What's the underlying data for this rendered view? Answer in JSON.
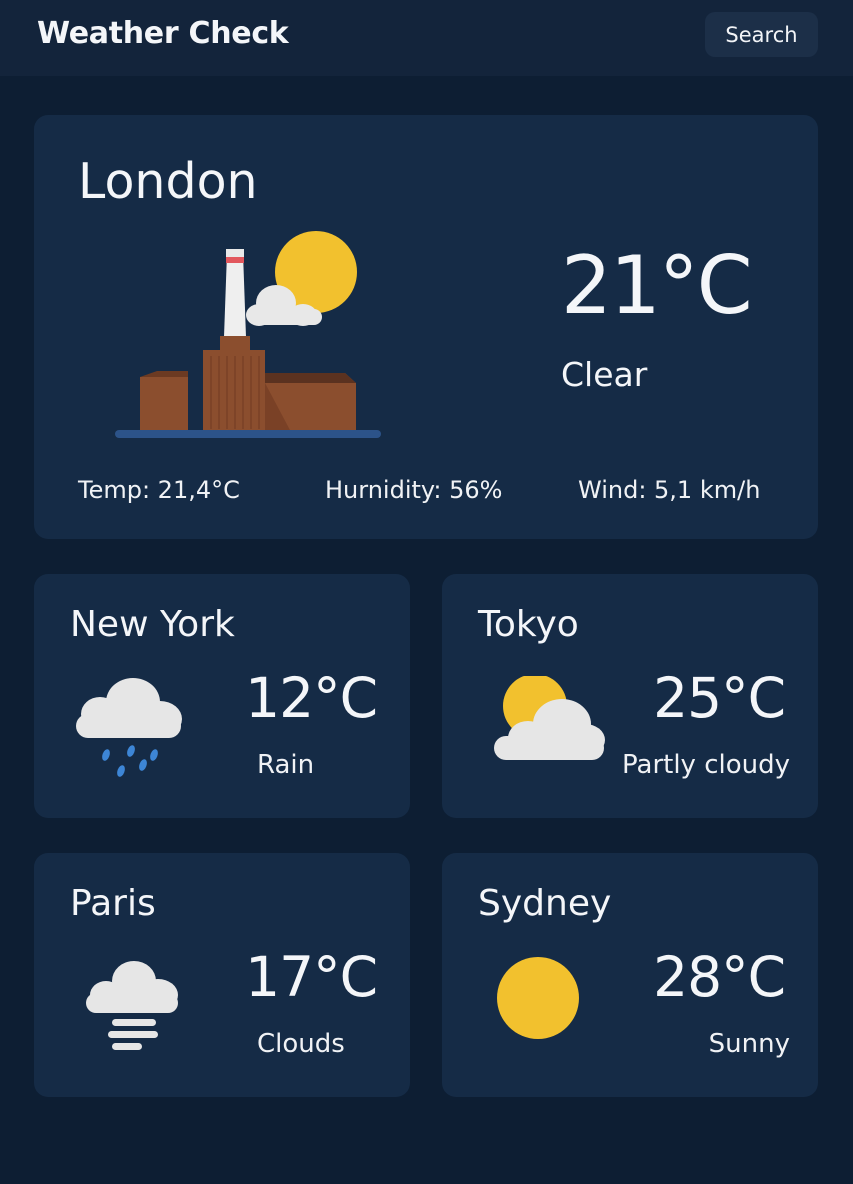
{
  "app": {
    "title": "Weather Check",
    "search_label": "Search"
  },
  "colors": {
    "background": "#0d1e33",
    "topbar": "#13243b",
    "card": "#152b46",
    "sun": "#f2c12e",
    "cloud": "#e6e6e6",
    "rain": "#3d86d6",
    "building": "#8b4e2e"
  },
  "featured": {
    "city": "London",
    "temperature": "21°C",
    "condition": "Clear",
    "icon": "london-power-station-sun-icon",
    "stats": {
      "temp": "Temp: 21,4°C",
      "humidity": "Hurnidity: 56%",
      "wind": "Wind: 5,1 km/h"
    }
  },
  "cities": [
    {
      "name": "New York",
      "temperature": "12°C",
      "condition": "Rain",
      "icon": "rain-cloud-icon"
    },
    {
      "name": "Tokyo",
      "temperature": "25°C",
      "condition": "Partly cloudy",
      "icon": "partly-cloudy-icon"
    },
    {
      "name": "Paris",
      "temperature": "17°C",
      "condition": "Clouds",
      "icon": "cloud-fog-icon"
    },
    {
      "name": "Sydney",
      "temperature": "28°C",
      "condition": "Sunny",
      "icon": "sun-icon"
    }
  ]
}
